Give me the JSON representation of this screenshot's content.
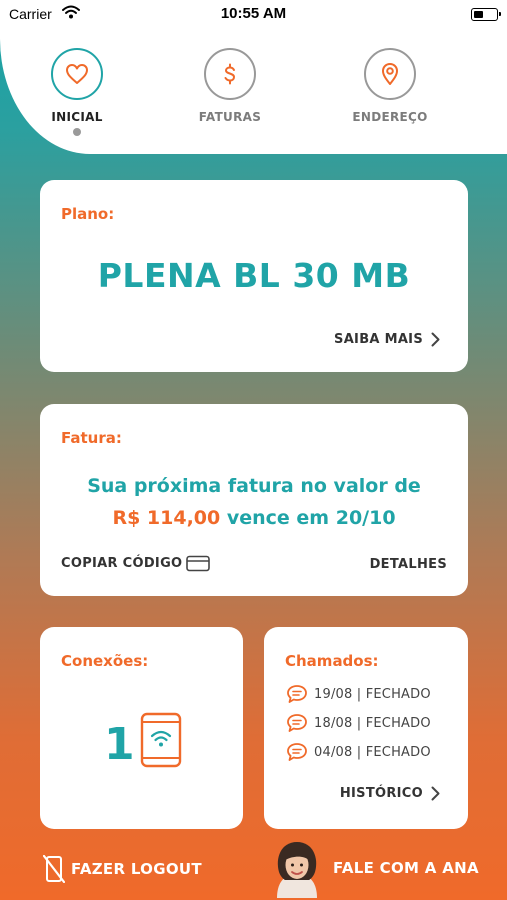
{
  "status": {
    "carrier": "Carrier",
    "time": "10:55 AM",
    "battery_level": 0.45
  },
  "nav": {
    "tabs": [
      {
        "label": "INICIAL",
        "icon": "heart-icon",
        "active": true
      },
      {
        "label": "FATURAS",
        "icon": "dollar-icon",
        "active": false
      },
      {
        "label": "ENDEREÇO",
        "icon": "location-pin-icon",
        "active": false
      }
    ]
  },
  "plan_card": {
    "title": "Plano:",
    "plan_name": "PLENA BL 30 MB",
    "more_label": "SAIBA MAIS"
  },
  "invoice_card": {
    "title": "Fatura:",
    "line1": "Sua próxima fatura no valor de",
    "amount": "R$ 114,00",
    "due_text": "vence em 20/10",
    "copy_code_label": "COPIAR CÓDIGO",
    "details_label": "DETALHES"
  },
  "connections_card": {
    "title": "Conexões:",
    "count": "1"
  },
  "tickets_card": {
    "title": "Chamados:",
    "items": [
      "19/08 | FECHADO",
      "18/08 | FECHADO",
      "04/08 | FECHADO"
    ],
    "history_label": "HISTÓRICO"
  },
  "footer": {
    "logout_label": "FAZER LOGOUT",
    "contact_label": "FALE COM A ANA"
  },
  "colors": {
    "teal": "#20a4a7",
    "orange": "#f06a2a",
    "card_bg": "#ffffff"
  }
}
